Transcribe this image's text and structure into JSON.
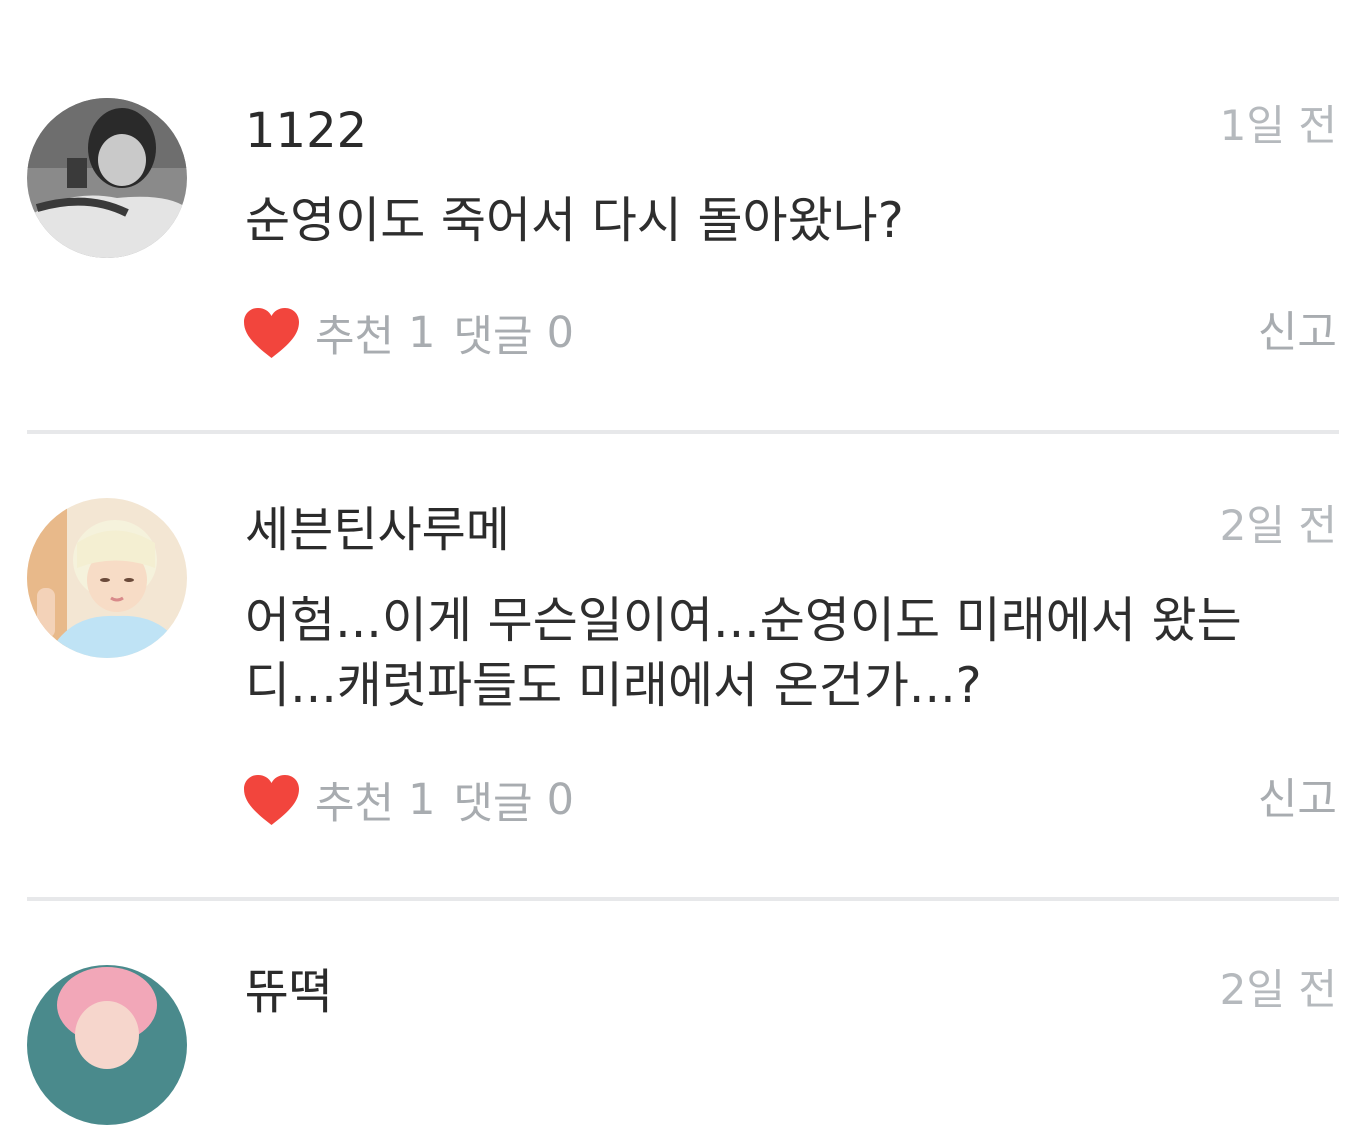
{
  "comments": [
    {
      "username": "1122",
      "time": "1일 전",
      "text": "순영이도 죽어서 다시 돌아왔나?",
      "like_label": "추천",
      "like_count": "1",
      "reply_label": "댓글",
      "reply_count": "0",
      "report_label": "신고"
    },
    {
      "username": "세븐틴사루메",
      "time": "2일 전",
      "text": "어험...이게 무슨일이여...순영이도 미래에서 왔는디...캐럿파들도 미래에서 온건가...?",
      "like_label": "추천",
      "like_count": "1",
      "reply_label": "댓글",
      "reply_count": "0",
      "report_label": "신고"
    },
    {
      "username": "뜌뗙",
      "time": "2일 전"
    }
  ],
  "colors": {
    "heart": "#f2453d",
    "meta_text": "#a8acb0",
    "divider": "#e7e8ea"
  }
}
